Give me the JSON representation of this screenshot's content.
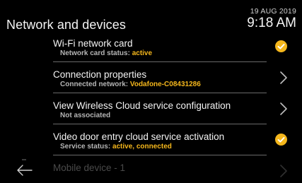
{
  "header": {
    "title": "Network and devices",
    "date": "19 AUG 2019",
    "time": "9:18 AM"
  },
  "colors": {
    "accent": "#f5b71c",
    "background": "#000000",
    "divider": "#6a6a6a"
  },
  "rows": [
    {
      "title": "Wi-Fi network card",
      "sub_label": "Network card status: ",
      "sub_value": "active",
      "icon": "check-circle-icon"
    },
    {
      "title": "Connection properties",
      "sub_label": "Connected network: ",
      "sub_value": "Vodafone-C08431286",
      "icon": "chevron-right-icon"
    },
    {
      "title": "View Wireless Cloud service configuration",
      "sub_label": "Not associated",
      "sub_value": "",
      "icon": "chevron-right-icon"
    },
    {
      "title": "Video door entry cloud service activation",
      "sub_label": "Service status: ",
      "sub_value": "active, connected",
      "icon": "check-circle-icon"
    },
    {
      "title": "Mobile device - 1",
      "icon": "chevron-right-icon"
    }
  ],
  "footer": {
    "back_icon": "back-arrow-icon"
  }
}
